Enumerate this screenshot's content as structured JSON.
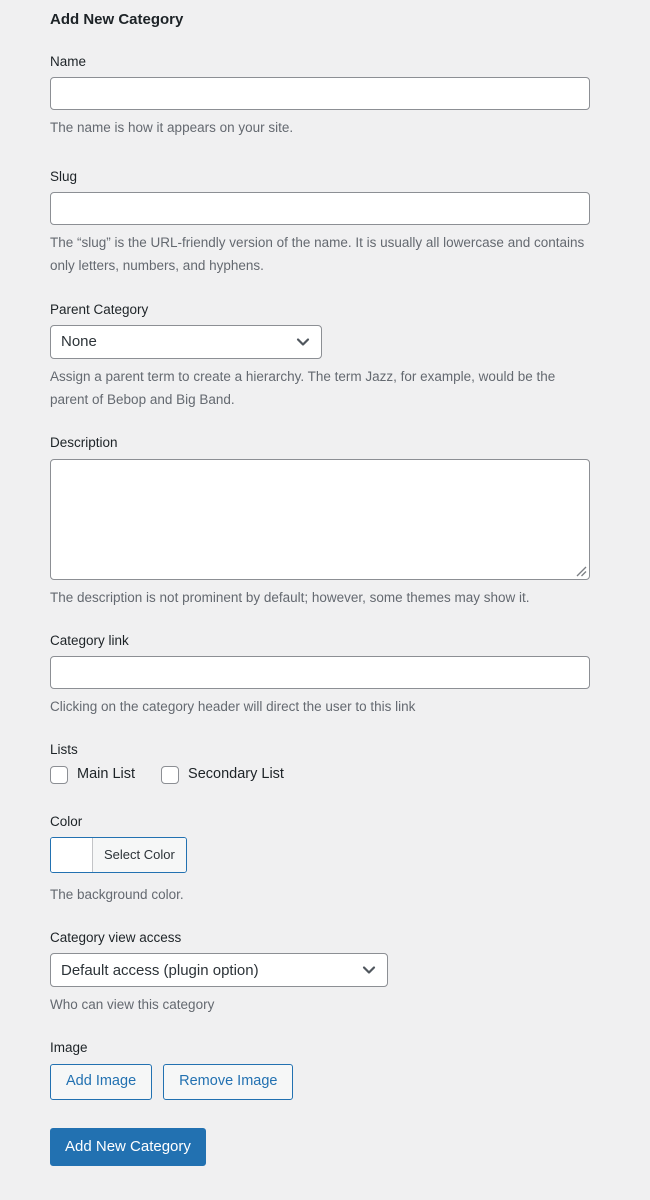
{
  "page": {
    "title": "Add New Category"
  },
  "fields": {
    "name": {
      "label": "Name",
      "value": "",
      "placeholder": "",
      "helper": "The name is how it appears on your site."
    },
    "slug": {
      "label": "Slug",
      "value": "",
      "placeholder": "",
      "helper": "The “slug” is the URL-friendly version of the name. It is usually all lowercase and contains only letters, numbers, and hyphens."
    },
    "parent_category": {
      "label": "Parent Category",
      "selected": "None",
      "helper": "Assign a parent term to create a hierarchy. The term Jazz, for example, would be the parent of Bebop and Big Band."
    },
    "description": {
      "label": "Description",
      "value": "",
      "placeholder": "",
      "helper": "The description is not prominent by default; however, some themes may show it."
    },
    "category_link": {
      "label": "Category link",
      "value": "",
      "placeholder": "",
      "helper": "Clicking on the category header will direct the user to this link"
    },
    "lists": {
      "label": "Lists",
      "options": [
        {
          "label": "Main List",
          "checked": false
        },
        {
          "label": "Secondary List",
          "checked": false
        }
      ]
    },
    "color": {
      "label": "Color",
      "button_label": "Select Color",
      "swatch_color": "#ffffff",
      "helper": "The background color."
    },
    "category_view_access": {
      "label": "Category view access",
      "selected": "Default access (plugin option)",
      "helper": "Who can view this category"
    },
    "image": {
      "label": "Image",
      "add_label": "Add Image",
      "remove_label": "Remove Image"
    }
  },
  "submit": {
    "label": "Add New Category"
  },
  "colors": {
    "page_background": "#f0f0f1",
    "primary": "#2271b1",
    "text": "#1d2327",
    "helper_text": "#646970",
    "input_border": "#8c8f94"
  }
}
